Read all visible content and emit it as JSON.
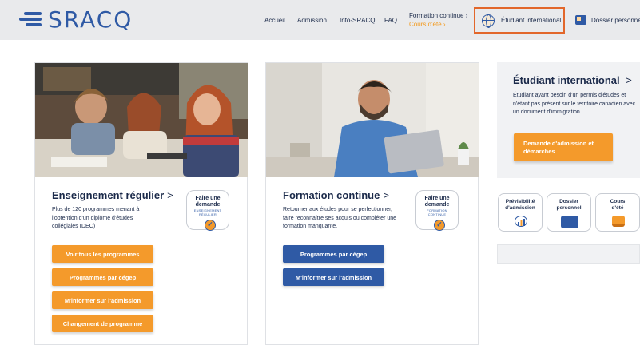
{
  "brand": {
    "name": "SRACQ",
    "color": "#2f5aa5",
    "accent": "#f49a2b",
    "highlight": "#e2672b"
  },
  "nav": {
    "accueil": "Accueil",
    "admission": "Admission",
    "info": "Info-SRACQ",
    "faq": "FAQ",
    "formation_continue": "Formation continue ›",
    "cours_ete": "Cours d'été ›",
    "etudiant_international": "Étudiant international",
    "dossier_personnel": "Dossier personnel"
  },
  "regular": {
    "title": "Enseignement régulier",
    "chevron": ">",
    "description": "Plus de 120 programmes menant à l'obtention d'un diplôme d'études collégiales (DEC)",
    "stamp": {
      "line1": "Faire une",
      "line2": "demande",
      "line3": "ENSEIGNEMENT",
      "line4": "RÉGULIER"
    },
    "buttons": [
      "Voir tous les programmes",
      "Programmes par cégep",
      "M'informer sur l'admission",
      "Changement de programme"
    ]
  },
  "continuing": {
    "title": "Formation continue",
    "chevron": ">",
    "description": "Retourner aux études pour se perfectionner, faire reconnaître ses acquis ou compléter une formation manquante.",
    "stamp": {
      "line1": "Faire une",
      "line2": "demande",
      "line3": "FORMATION",
      "line4": "CONTINUE"
    },
    "buttons": [
      "Programmes par cégep",
      "M'informer sur l'admission"
    ]
  },
  "international": {
    "title": "Étudiant international",
    "chevron": ">",
    "description": "Étudiant ayant besoin d'un permis d'études et n'étant pas présent sur le territoire canadien avec un document d'immigration",
    "button": "Demande d'admission et démarches"
  },
  "tiles": [
    {
      "label1": "Prévisibilité",
      "label2": "d'admission",
      "icon": "chart-icon"
    },
    {
      "label1": "Dossier",
      "label2": "personnel",
      "icon": "folder-icon"
    },
    {
      "label1": "Cours",
      "label2": "d'été",
      "icon": "books-icon"
    }
  ]
}
